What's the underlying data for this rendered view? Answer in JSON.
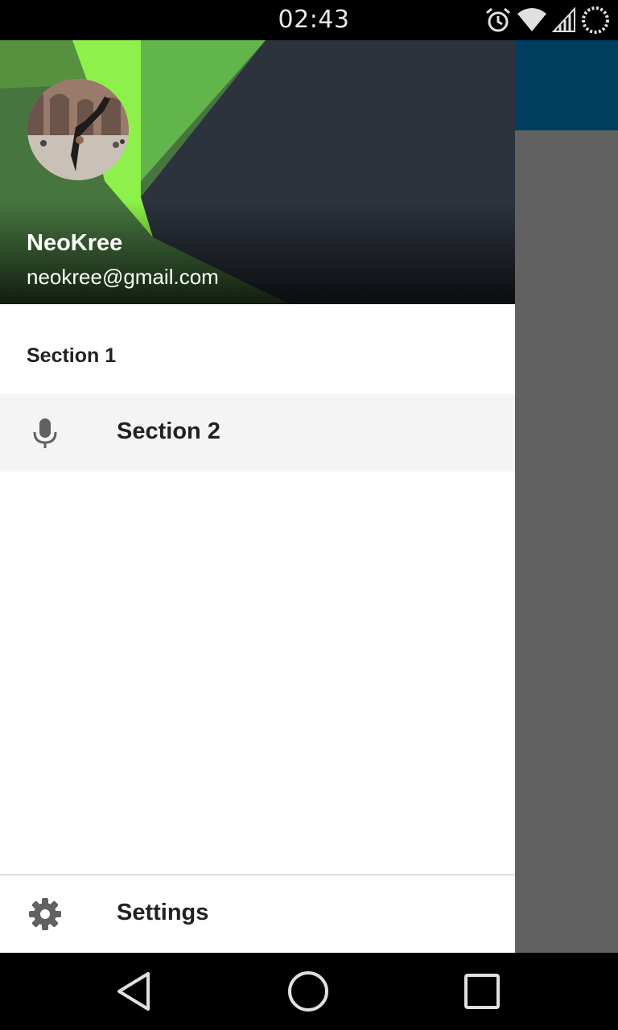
{
  "status_bar": {
    "time": "02:43",
    "icons": [
      "alarm-icon",
      "wifi-icon",
      "signal-icon",
      "loading-icon"
    ]
  },
  "drawer": {
    "header": {
      "user_name": "NeoKree",
      "user_email": "neokree@gmail.com",
      "avatar": "avatar-photo"
    },
    "section_header": "Section 1",
    "items": [
      {
        "label": "Section 2",
        "icon": "microphone-icon",
        "active": true
      }
    ],
    "bottom_items": [
      {
        "label": "Settings",
        "icon": "gear-icon"
      }
    ]
  },
  "navigation_bar": {
    "buttons": [
      "back-icon",
      "home-icon",
      "recents-icon"
    ]
  },
  "colors": {
    "toolbar": "#003e5f",
    "scrim": "#616161",
    "accent_green": "#8ef04a",
    "header_dark": "#2c333d",
    "active_item_bg": "#f4f4f4"
  }
}
